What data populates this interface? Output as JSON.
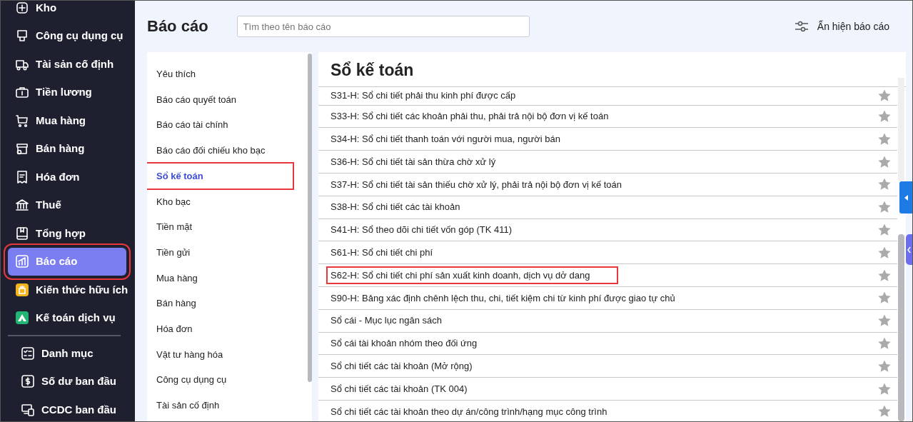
{
  "sidebar": {
    "sections": [
      {
        "items": [
          {
            "label": "Kho",
            "kind": "line",
            "selected": false,
            "highlighted": false
          },
          {
            "label": "Công cụ dụng cụ",
            "kind": "line",
            "selected": false,
            "highlighted": false
          },
          {
            "label": "Tài sản cố định",
            "kind": "line",
            "selected": false,
            "highlighted": false
          },
          {
            "label": "Tiền lương",
            "kind": "line",
            "selected": false,
            "highlighted": false
          },
          {
            "label": "Mua hàng",
            "kind": "line",
            "selected": false,
            "highlighted": false
          },
          {
            "label": "Bán hàng",
            "kind": "line",
            "selected": false,
            "highlighted": false
          },
          {
            "label": "Hóa đơn",
            "kind": "line",
            "selected": false,
            "highlighted": false
          },
          {
            "label": "Thuế",
            "kind": "line",
            "selected": false,
            "highlighted": false
          },
          {
            "label": "Tổng hợp",
            "kind": "line",
            "selected": false,
            "highlighted": false
          },
          {
            "label": "Báo cáo",
            "kind": "line",
            "selected": true,
            "highlighted": true
          },
          {
            "label": "Kiến thức hữu ích",
            "kind": "badge",
            "color": "#f2b320",
            "selected": false,
            "highlighted": false
          },
          {
            "label": "Kế toán dịch vụ",
            "kind": "badge",
            "color": "#22b573",
            "selected": false,
            "highlighted": false
          }
        ]
      },
      {
        "items": [
          {
            "label": "Danh mục",
            "kind": "line",
            "selected": false,
            "highlighted": false
          },
          {
            "label": "Số dư ban đầu",
            "kind": "line",
            "selected": false,
            "highlighted": false
          },
          {
            "label": "CCDC ban đầu",
            "kind": "line",
            "selected": false,
            "highlighted": false
          }
        ]
      }
    ]
  },
  "header": {
    "title": "Báo cáo",
    "search": {
      "placeholder": "Tìm theo tên báo cáo"
    },
    "toggle_button": "Ẩn hiện báo cáo"
  },
  "categories": [
    {
      "label": "Yêu thích",
      "selected": false,
      "highlighted": false
    },
    {
      "label": "Báo cáo quyết toán",
      "selected": false,
      "highlighted": false
    },
    {
      "label": "Báo cáo tài chính",
      "selected": false,
      "highlighted": false
    },
    {
      "label": "Báo cáo đối chiếu kho bạc",
      "selected": false,
      "highlighted": false
    },
    {
      "label": "Sổ kế toán",
      "selected": true,
      "highlighted": true
    },
    {
      "label": "Kho bạc",
      "selected": false,
      "highlighted": false
    },
    {
      "label": "Tiền mặt",
      "selected": false,
      "highlighted": false
    },
    {
      "label": "Tiền gửi",
      "selected": false,
      "highlighted": false
    },
    {
      "label": "Mua hàng",
      "selected": false,
      "highlighted": false
    },
    {
      "label": "Bán hàng",
      "selected": false,
      "highlighted": false
    },
    {
      "label": "Hóa đơn",
      "selected": false,
      "highlighted": false
    },
    {
      "label": "Vật tư hàng hóa",
      "selected": false,
      "highlighted": false
    },
    {
      "label": "Công cụ dụng cụ",
      "selected": false,
      "highlighted": false
    },
    {
      "label": "Tài sản cố định",
      "selected": false,
      "highlighted": false
    }
  ],
  "reports": {
    "title": "Sổ kế toán",
    "rows": [
      {
        "name": "S31-H: Sổ chi tiết phải thu kinh phí được cấp",
        "favorite": false,
        "highlighted": false
      },
      {
        "name": "S33-H: Sổ chi tiết các khoản phải thu, phải trả nội bộ đơn vị kế toán",
        "favorite": false,
        "highlighted": false
      },
      {
        "name": "S34-H: Sổ chi tiết thanh toán với người mua, người bán",
        "favorite": false,
        "highlighted": false
      },
      {
        "name": "S36-H: Sổ chi tiết tài sản thừa chờ xử lý",
        "favorite": false,
        "highlighted": false
      },
      {
        "name": "S37-H: Sổ chi tiết tài sản thiếu chờ xử lý, phải trả nội bộ đơn vị kế toán",
        "favorite": false,
        "highlighted": false
      },
      {
        "name": "S38-H: Sổ chi tiết các tài khoản",
        "favorite": false,
        "highlighted": false
      },
      {
        "name": "S41-H: Sổ theo dõi chi tiết vốn góp (TK 411)",
        "favorite": false,
        "highlighted": false
      },
      {
        "name": "S61-H: Sổ chi tiết chi phí",
        "favorite": false,
        "highlighted": false
      },
      {
        "name": "S62-H: Sổ chi tiết chi phí sản xuất kinh doanh, dịch vụ dở dang",
        "favorite": false,
        "highlighted": true
      },
      {
        "name": "S90-H: Bảng xác định chênh lệch thu, chi, tiết kiệm chi từ kinh phí được giao tự chủ",
        "favorite": false,
        "highlighted": false
      },
      {
        "name": "Sổ cái - Mục lục ngân sách",
        "favorite": false,
        "highlighted": false
      },
      {
        "name": "Sổ cái tài khoản nhóm theo đối ứng",
        "favorite": false,
        "highlighted": false
      },
      {
        "name": "Sổ chi tiết các tài khoản (Mở rộng)",
        "favorite": false,
        "highlighted": false
      },
      {
        "name": "Sổ chi tiết các tài khoản (TK 004)",
        "favorite": false,
        "highlighted": false
      },
      {
        "name": "Sổ chi tiết các tài khoản theo dự án/công trình/hạng mục công trình",
        "favorite": false,
        "highlighted": false
      }
    ]
  }
}
